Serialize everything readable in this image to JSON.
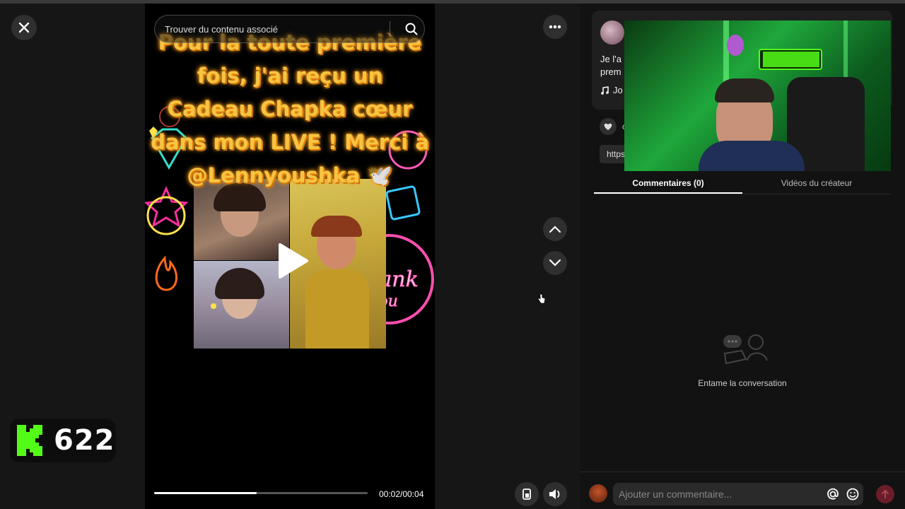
{
  "search": {
    "placeholder": "Trouver du contenu associé"
  },
  "video": {
    "caption": "Pour la toute première fois, j'ai reçu un Cadeau Chapka cœur dans mon LIVE ! Merci à @Lennyoushka 🕊️",
    "progress_fraction": 0.48,
    "timer": "00:02/00:04"
  },
  "overlay": {
    "kick_count": "622",
    "kick_letter": "K"
  },
  "info": {
    "description_line1": "Je l'a",
    "description_line2": "prem",
    "music": "Jo",
    "like_count": "c",
    "link": "https:"
  },
  "tabs": [
    {
      "label": "Commentaires (0)"
    },
    {
      "label": "Vidéos du créateur"
    }
  ],
  "comments": {
    "empty_text": "Entame la conversation"
  },
  "comment_box": {
    "placeholder": "Ajouter un commentaire..."
  },
  "icons": [
    "close-icon",
    "search-icon",
    "more-icon",
    "chevron-up-icon",
    "chevron-down-icon",
    "play-icon",
    "mobile-icon",
    "volume-icon",
    "heart-icon",
    "music-icon",
    "at-icon",
    "emoji-icon",
    "send-icon"
  ],
  "colors": {
    "background": "#121212",
    "caption": "#f5c542",
    "kick_green": "#53fc18",
    "send": "#6b1d2a"
  }
}
